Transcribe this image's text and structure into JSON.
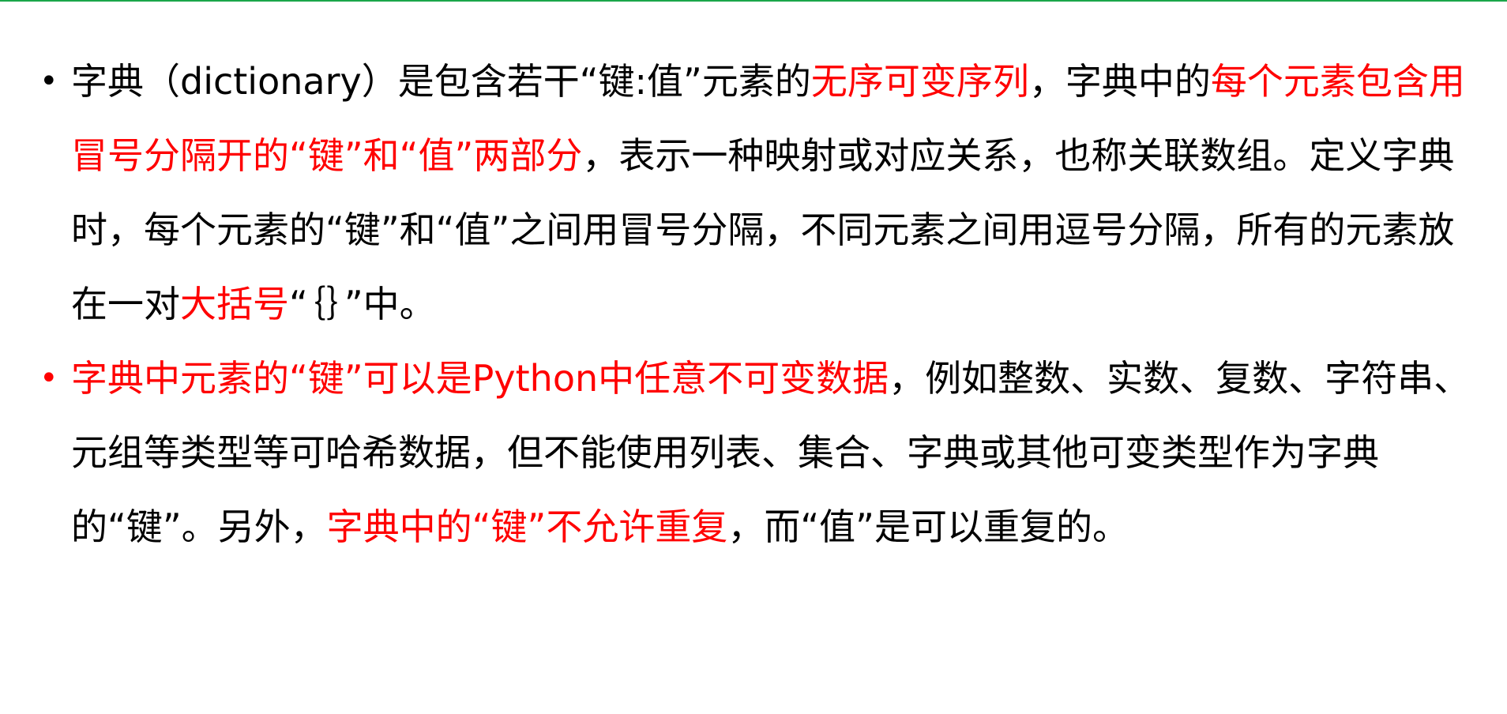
{
  "colors": {
    "accent_line": "#1aa64a",
    "highlight": "#ff0000",
    "text": "#000000"
  },
  "bullets": [
    {
      "marker_color": "#000000",
      "segments": [
        {
          "text": "字典（dictionary）是包含若干“键:值”元素的",
          "color": "#000000"
        },
        {
          "text": "无序可变序列",
          "color": "#ff0000"
        },
        {
          "text": "，字典中的",
          "color": "#000000"
        },
        {
          "text": "每个元素包含用冒号分隔开的“键”和“值”两部分",
          "color": "#ff0000"
        },
        {
          "text": "，表示一种映射或对应关系，也称关联数组。定义字典时，每个元素的“键”和“值”之间用冒号分隔，不同元素之间用逗号分隔，所有的元素放在一对",
          "color": "#000000"
        },
        {
          "text": "大括号",
          "color": "#ff0000"
        },
        {
          "text": "“｛｝”中。",
          "color": "#000000"
        }
      ]
    },
    {
      "marker_color": "#ff0000",
      "segments": [
        {
          "text": "字典中元素的“键”可以是Python中任意不可变数据",
          "color": "#ff0000"
        },
        {
          "text": "，例如整数、实数、复数、字符串、元组等类型等可哈希数据，但不能使用列表、集合、字典或其他可变类型作为字典的“键”。另外，",
          "color": "#000000"
        },
        {
          "text": "字典中的“键”不允许重复",
          "color": "#ff0000"
        },
        {
          "text": "，而“值”是可以重复的。",
          "color": "#000000"
        }
      ]
    }
  ]
}
